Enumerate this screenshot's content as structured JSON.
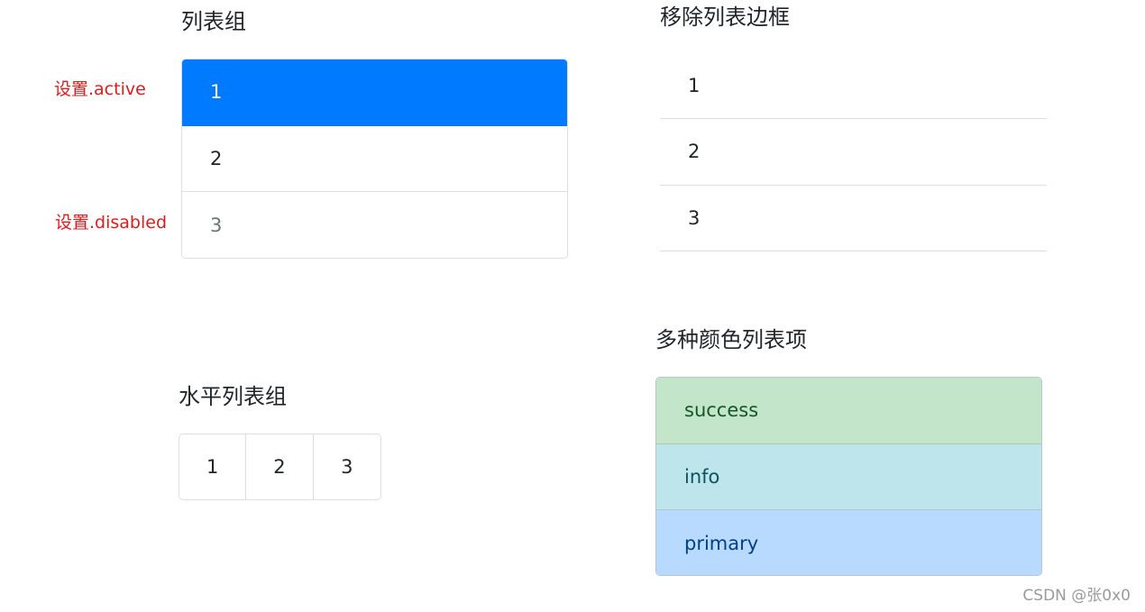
{
  "sections": {
    "list_group": {
      "title": "列表组",
      "items": [
        "1",
        "2",
        "3"
      ],
      "active_annotation": "设置.active",
      "disabled_annotation": "设置.disabled"
    },
    "flush_list": {
      "title": "移除列表边框",
      "items": [
        "1",
        "2",
        "3"
      ]
    },
    "horizontal_list": {
      "title": "水平列表组",
      "items": [
        "1",
        "2",
        "3"
      ]
    },
    "colored_list": {
      "title": "多种颜色列表项",
      "items": [
        {
          "label": "success",
          "bg": "#c3e6cb",
          "fg": "#155724"
        },
        {
          "label": "info",
          "bg": "#bee5eb",
          "fg": "#0c5460"
        },
        {
          "label": "primary",
          "bg": "#b8daff",
          "fg": "#004085"
        }
      ]
    }
  },
  "colors": {
    "active": "#007bff",
    "annotation": "#dc1c1c"
  },
  "watermark": "CSDN @张0x0"
}
